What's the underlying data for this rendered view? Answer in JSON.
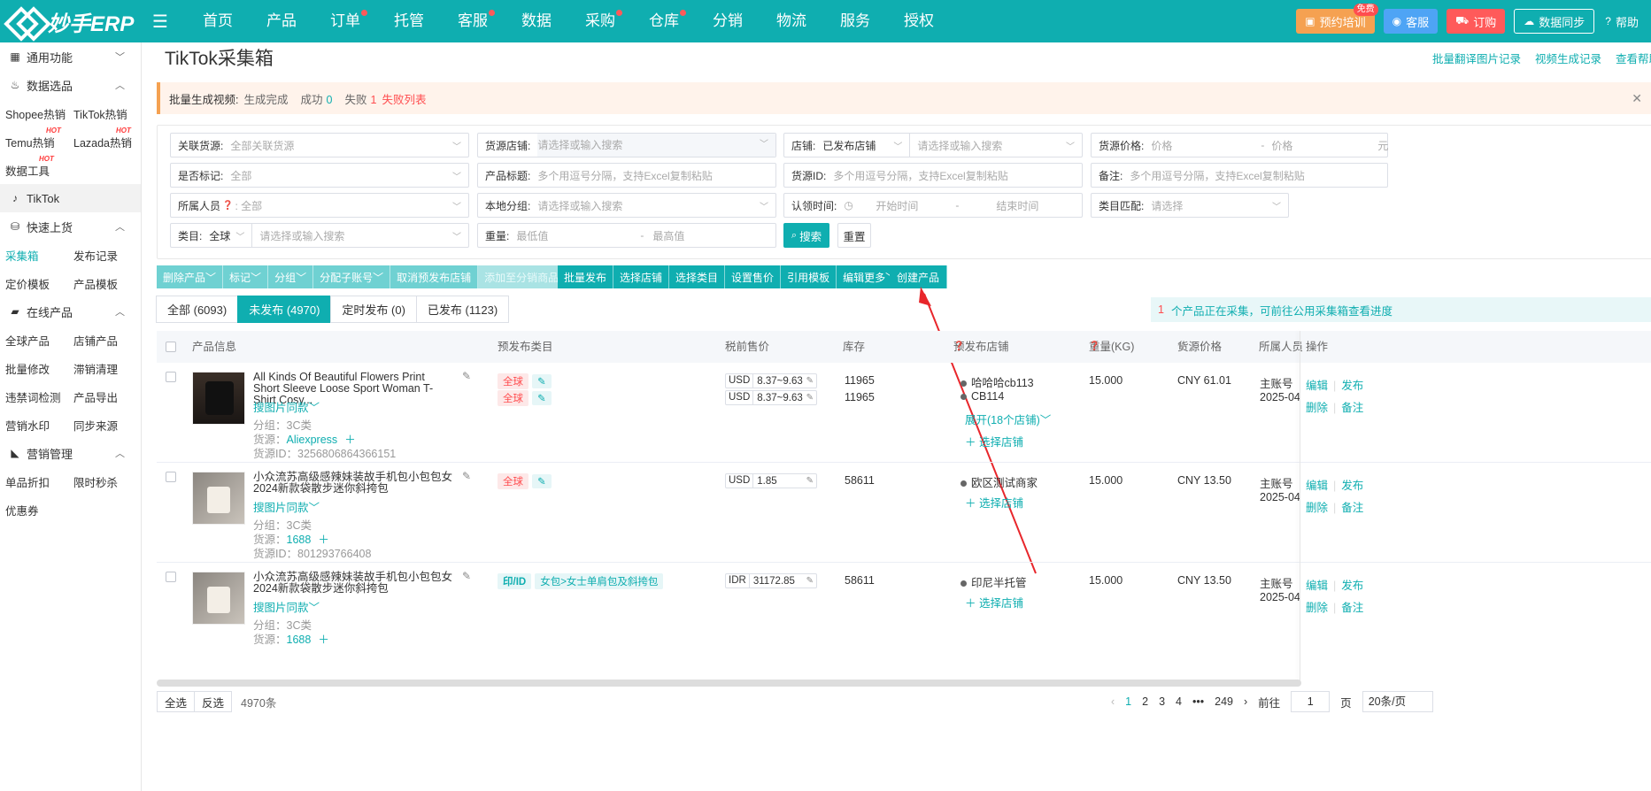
{
  "topnav": {
    "brand": "妙手ERP",
    "items": [
      {
        "label": "首页",
        "dot": false
      },
      {
        "label": "产品",
        "dot": false
      },
      {
        "label": "订单",
        "dot": true
      },
      {
        "label": "托管",
        "dot": false
      },
      {
        "label": "客服",
        "dot": true
      },
      {
        "label": "数据",
        "dot": false
      },
      {
        "label": "采购",
        "dot": true
      },
      {
        "label": "仓库",
        "dot": true
      },
      {
        "label": "分销",
        "dot": false
      },
      {
        "label": "物流",
        "dot": false
      },
      {
        "label": "服务",
        "dot": false
      },
      {
        "label": "授权",
        "dot": false
      }
    ],
    "training": "预约培训",
    "training_badge": "免费",
    "service": "客服",
    "order": "订购",
    "sync": "数据同步",
    "help": "帮助",
    "colors": {
      "brand": "#0faeb0",
      "training": "#f5a151",
      "service": "#4ea4f5",
      "order": "#ff5a5a"
    }
  },
  "sidebar": {
    "general": "通用功能",
    "data_select": "数据选品",
    "data_items": [
      [
        "Shopee热销",
        "TikTok热销"
      ],
      [
        "Temu热销",
        "Lazada热销"
      ],
      [
        "数据工具",
        ""
      ]
    ],
    "hot": "HOT",
    "tiktok": "TikTok",
    "quick_upload": "快速上货",
    "quick_items": [
      [
        "采集箱",
        "发布记录"
      ],
      [
        "定价模板",
        "产品模板"
      ]
    ],
    "online": "在线产品",
    "online_items": [
      [
        "全球产品",
        "店铺产品"
      ],
      [
        "批量修改",
        "滞销清理"
      ],
      [
        "违禁词检测",
        "产品导出"
      ],
      [
        "营销水印",
        "同步来源"
      ]
    ],
    "marketing": "营销管理",
    "marketing_items": [
      [
        "单品折扣",
        "限时秒杀"
      ],
      [
        "优惠券",
        ""
      ]
    ]
  },
  "page": {
    "title": "TikTok采集箱",
    "links": [
      "批量翻译图片记录",
      "视频生成记录",
      "查看帮助"
    ]
  },
  "alert": {
    "label": "批量生成视频:",
    "status": "生成完成",
    "success_label": "成功",
    "success": "0",
    "fail_label": "失败",
    "fail": "1",
    "fail_link": "失败列表"
  },
  "filters": {
    "source_label": "关联货源:",
    "source_val": "全部关联货源",
    "store_src_label": "货源店铺:",
    "store_src_ph": "请选择或输入搜索",
    "store_label": "店铺:",
    "store_val": "已发布店铺",
    "store_ph": "请选择或输入搜索",
    "price_label": "货源价格:",
    "price_min": "价格",
    "price_dash": "-",
    "price_max": "价格",
    "price_unit": "元",
    "mark_label": "是否标记:",
    "mark_val": "全部",
    "title_label": "产品标题:",
    "title_ph": "多个用逗号分隔，支持Excel复制粘贴",
    "srcid_label": "货源ID:",
    "srcid_ph": "多个用逗号分隔，支持Excel复制粘贴",
    "note_label": "备注:",
    "note_ph": "多个用逗号分隔，支持Excel复制粘贴",
    "owner_label": "所属人员",
    "owner_val": "全部",
    "group_label": "本地分组:",
    "group_ph": "请选择或输入搜索",
    "claim_label": "认领时间:",
    "claim_start": "开始时间",
    "claim_dash": "-",
    "claim_end": "结束时间",
    "cat_match_label": "类目匹配:",
    "cat_match_ph": "请选择",
    "cat_label": "类目:",
    "cat_val": "全球",
    "cat_ph": "请选择或输入搜索",
    "weight_label": "重量:",
    "weight_min": "最低值",
    "weight_dash": "-",
    "weight_max": "最高值",
    "search": "搜索",
    "reset": "重置"
  },
  "actions": {
    "group1": [
      "删除产品",
      "标记",
      "分组",
      "分配子账号",
      "取消预发布店铺",
      "添加至分销商品"
    ],
    "group2": [
      "批量发布",
      "选择店铺",
      "选择类目",
      "设置售价",
      "引用模板",
      "编辑更多"
    ],
    "create": "创建产品"
  },
  "tabs": [
    "全部 (6093)",
    "未发布 (4970)",
    "定时发布 (0)",
    "已发布 (1123)"
  ],
  "collect_note": {
    "count": "1",
    "text": "个产品正在采集，可前往公用采集箱查看进度"
  },
  "table": {
    "headers": [
      "产品信息",
      "预发布类目",
      "税前售价",
      "库存",
      "预发布店铺",
      "重量(KG)",
      "货源价格",
      "所属人员",
      "操作"
    ],
    "rows": [
      {
        "title": "All Kinds Of Beautiful Flowers Print Short Sleeve Loose Sport Woman T-Shirt Cosy...",
        "img_search": "搜图片同款",
        "group": "分组：3C类",
        "source_label": "货源：",
        "source": "Aliexpress",
        "srcid": "货源ID：3256806864366151",
        "cats": [
          "全球",
          "全球"
        ],
        "prices": [
          {
            "cur": "USD",
            "val": "8.37~9.63"
          },
          {
            "cur": "USD",
            "val": "8.37~9.63"
          }
        ],
        "stock": [
          "11965",
          "11965"
        ],
        "stores": [
          "哈哈哈cb113",
          "CB114"
        ],
        "expand": "展开(18个店铺)",
        "add_store": "选择店铺",
        "weight": "15.000",
        "src_price": "CNY 61.01",
        "owner": "主账号",
        "date": "2025-04"
      },
      {
        "title": "小众流苏高级感辣妹装故手机包小包包女2024新款袋散步迷你斜挎包",
        "img_search": "搜图片同款",
        "group": "分组：3C类",
        "source_label": "货源：",
        "source": "1688",
        "srcid": "货源ID：801293766408",
        "cats": [
          "全球"
        ],
        "prices": [
          {
            "cur": "USD",
            "val": "1.85"
          }
        ],
        "stock": [
          "58611"
        ],
        "stores": [
          "欧区测试商家"
        ],
        "add_store": "选择店铺",
        "weight": "15.000",
        "src_price": "CNY 13.50",
        "owner": "主账号",
        "date": "2025-04"
      },
      {
        "title": "小众流苏高级感辣妹装故手机包小包包女2024新款袋散步迷你斜挎包",
        "img_search": "搜图片同款",
        "group": "分组：3C类",
        "source_label": "货源：",
        "source": "1688",
        "cat_region": "印/ID",
        "cat_path": "女包>女士单肩包及斜挎包",
        "prices": [
          {
            "cur": "IDR",
            "val": "31172.85"
          }
        ],
        "stock": [
          "58611"
        ],
        "stores": [
          "印尼半托管"
        ],
        "add_store": "选择店铺",
        "weight": "15.000",
        "src_price": "CNY 13.50",
        "owner": "主账号",
        "date": "2025-04"
      }
    ],
    "ops": {
      "edit": "编辑",
      "publish": "发布",
      "delete": "删除",
      "note": "备注"
    }
  },
  "footer": {
    "select_all": "全选",
    "invert": "反选",
    "total": "4970条",
    "pages": [
      "1",
      "2",
      "3",
      "4",
      "•••",
      "249"
    ],
    "goto": "前往",
    "page_val": "1",
    "page_unit": "页",
    "per_page": "20条/页"
  }
}
